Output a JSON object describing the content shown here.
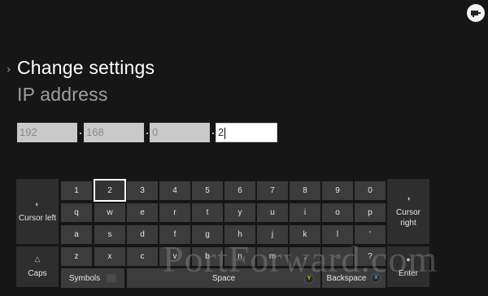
{
  "header": {
    "title": "Change settings",
    "subtitle": "IP address"
  },
  "ip_fields": [
    {
      "value": "192"
    },
    {
      "value": "168"
    },
    {
      "value": "0"
    },
    {
      "value": "2"
    }
  ],
  "keyboard": {
    "number_row": [
      "1",
      "2",
      "3",
      "4",
      "5",
      "6",
      "7",
      "8",
      "9",
      "0"
    ],
    "row_q": [
      "q",
      "w",
      "e",
      "r",
      "t",
      "y",
      "u",
      "i",
      "o",
      "p"
    ],
    "row_a": [
      "a",
      "s",
      "d",
      "f",
      "g",
      "h",
      "j",
      "k",
      "l",
      "'"
    ],
    "row_z": [
      "z",
      "x",
      "c",
      "v",
      "b",
      "n",
      "m",
      ",",
      ".",
      "?"
    ],
    "cursor_left": "Cursor left",
    "cursor_right": "Cursor right",
    "caps": "Caps",
    "symbols": "Symbols",
    "space": "Space",
    "backspace": "Backspace",
    "enter": "Enter",
    "focused_key": "2"
  },
  "watermark": "PortForward.com",
  "colors": {
    "background": "#161616",
    "key": "#3c3c3c",
    "field": "#c9c9c9",
    "y_button": "#f2c300",
    "x_button": "#3aa0ff"
  }
}
